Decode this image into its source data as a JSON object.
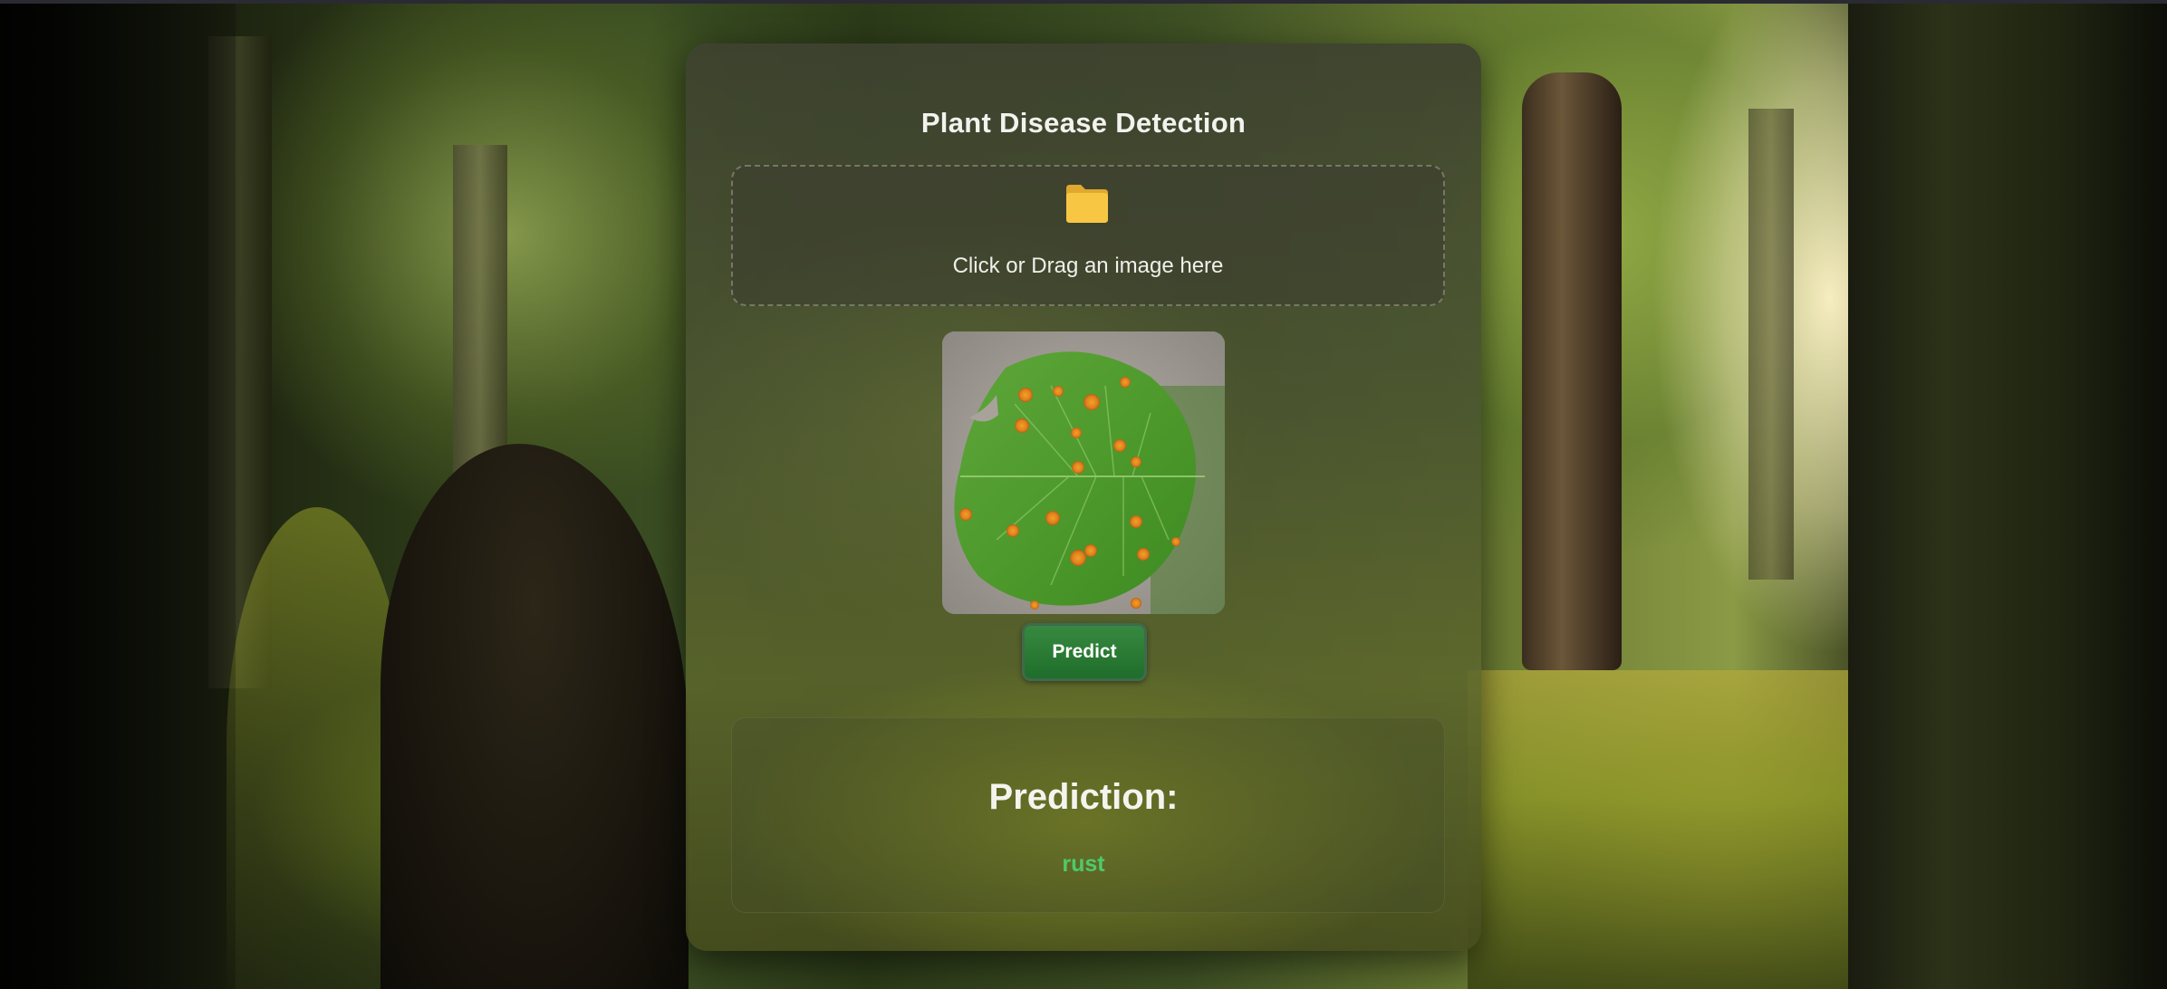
{
  "app": {
    "title": "Plant Disease Detection"
  },
  "upload": {
    "icon": "folder-icon",
    "prompt": "Click or Drag an image here"
  },
  "preview": {
    "alt": "leaf with orange rust spots"
  },
  "actions": {
    "predict_label": "Predict"
  },
  "result": {
    "heading": "Prediction:",
    "value": "rust"
  },
  "colors": {
    "predict_button": "#2a7d35",
    "result_value": "#4ec96a",
    "folder": "#f5c542"
  }
}
